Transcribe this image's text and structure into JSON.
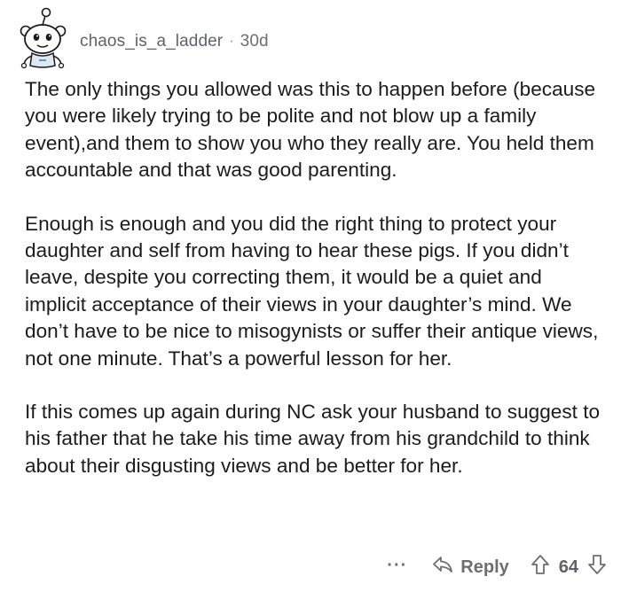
{
  "comment": {
    "username": "chaos_is_a_ladder",
    "separator": "·",
    "age": "30d",
    "avatar_icon": "snoo-avatar-icon",
    "paragraphs": [
      "The only things you allowed was this to happen before (because you were likely trying to be polite and not blow up a family event),and them to show you who they really are. You held them accountable and that was good parenting.",
      "Enough is enough and you did the right thing to protect your daughter and self from having to hear these pigs. If you didn’t leave, despite you correcting them, it would be a quiet and implicit acceptance of their views in your daughter’s mind. We don’t have to be nice to misogynists or suffer their antique views, not one minute. That’s a powerful lesson for her.",
      "If this comes up again during NC ask your husband to suggest to his father that he take his time away from his grandchild to think about their disgusting views and be better for her."
    ]
  },
  "actions": {
    "more_label": "···",
    "reply_label": "Reply",
    "score": "64",
    "icons": {
      "reply": "reply-arrow-icon",
      "upvote": "upvote-arrow-icon",
      "downvote": "downvote-arrow-icon"
    }
  },
  "colors": {
    "meta_text": "#6b6e72",
    "body_text": "#1c1c1c",
    "background": "#ffffff"
  }
}
